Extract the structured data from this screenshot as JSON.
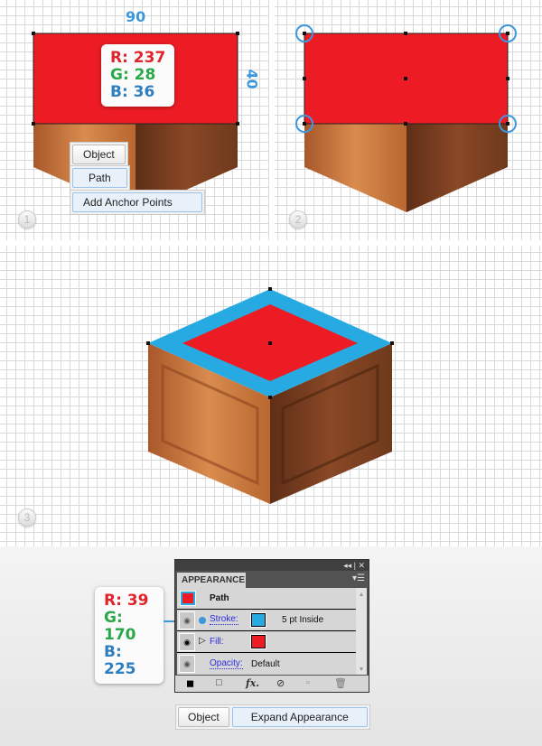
{
  "colors": {
    "fill_red": "#ED1C24",
    "stroke_blue": "#27AAE1"
  },
  "step1": {
    "badge": "1",
    "width": "90",
    "height": "40",
    "rgb": {
      "r": "R: 237",
      "g": "G: 28",
      "b": "B: 36"
    },
    "menu": [
      "Object",
      "Path",
      "Add Anchor Points"
    ]
  },
  "step2": {
    "badge": "2"
  },
  "step3": {
    "badge": "3"
  },
  "appearance": {
    "title": "APPEARANCE",
    "collapse": "◂◂ | ✕",
    "menu_icon": "▾☰",
    "object": "Path",
    "stroke_label": "Stroke:",
    "stroke_value": "5 pt  Inside",
    "fill_label": "Fill:",
    "opacity_label": "Opacity:",
    "opacity_value": "Default",
    "footer_icons": [
      "add-new-stroke-icon",
      "add-new-fill-icon",
      "fx-icon",
      "clear-appearance-icon",
      "duplicate-item-icon",
      "delete-item-icon"
    ],
    "fx": "fx."
  },
  "stroke_rgb": {
    "r": "R: 39",
    "g": "G: 170",
    "b": "B: 225"
  },
  "bottom_menu": [
    "Object",
    "Expand Appearance"
  ]
}
